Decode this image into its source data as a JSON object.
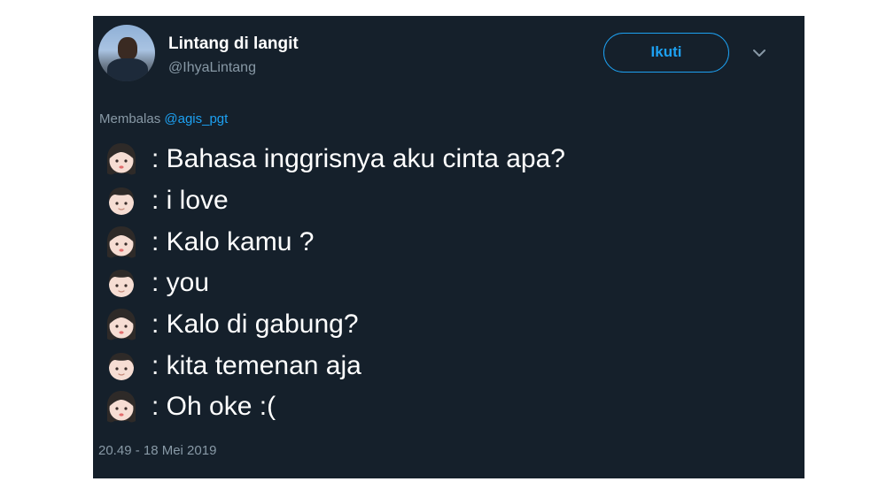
{
  "user": {
    "display_name": "Lintang di langit",
    "handle": "@IhyaLintang"
  },
  "follow_button_label": "Ikuti",
  "reply": {
    "prefix": "Membalas",
    "mention": "@agis_pgt"
  },
  "lines": [
    {
      "speaker": "woman-face-icon",
      "text": ": Bahasa inggrisnya aku cinta apa?"
    },
    {
      "speaker": "man-face-icon",
      "text": ": i love"
    },
    {
      "speaker": "woman-face-icon",
      "text": ": Kalo kamu ?"
    },
    {
      "speaker": "man-face-icon",
      "text": ": you"
    },
    {
      "speaker": "woman-face-icon",
      "text": ": Kalo di gabung?"
    },
    {
      "speaker": "man-face-icon",
      "text": ": kita temenan aja"
    },
    {
      "speaker": "woman-face-icon",
      "text": ": Oh oke :("
    }
  ],
  "timestamp": "20.49 - 18 Mei 2019",
  "colors": {
    "background": "#15202b",
    "accent": "#1da1f2",
    "secondary_text": "#8899a6"
  }
}
